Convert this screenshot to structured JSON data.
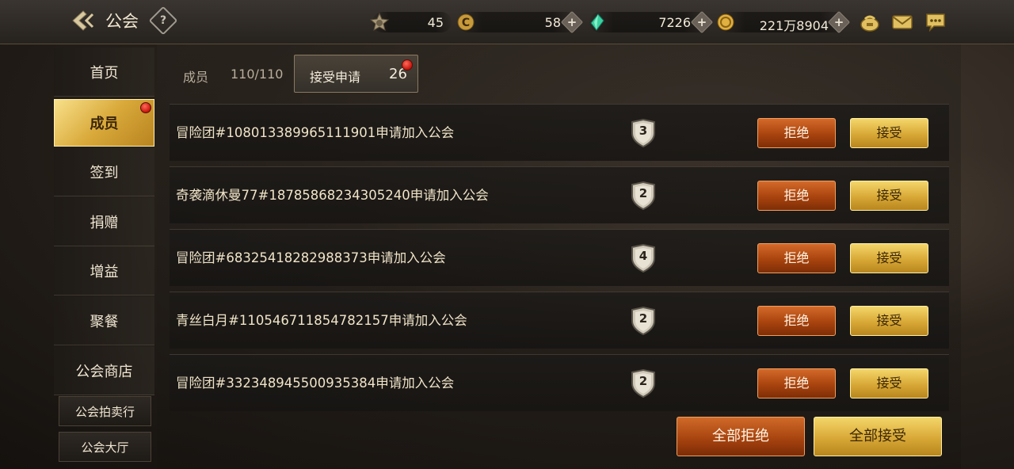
{
  "header": {
    "title": "公会",
    "help_label": "?",
    "resources": [
      {
        "icon": "star-badge-icon",
        "value": "45"
      },
      {
        "icon": "c-coin-icon",
        "value": "58"
      },
      {
        "icon": "green-crystal-icon",
        "value": "7226"
      },
      {
        "icon": "gold-coin-icon",
        "value": "221万8904"
      }
    ],
    "plus_label": "+",
    "right_icons": [
      "bag-icon",
      "mail-icon",
      "chat-icon"
    ]
  },
  "sidebar": {
    "items": [
      {
        "label": "首页"
      },
      {
        "label": "成员"
      },
      {
        "label": "签到"
      },
      {
        "label": "捐赠"
      },
      {
        "label": "增益"
      },
      {
        "label": "聚餐"
      },
      {
        "label": "公会商店"
      }
    ],
    "sub_items": [
      {
        "label": "公会拍卖行"
      },
      {
        "label": "公会大厅"
      }
    ]
  },
  "tabs": {
    "members_label": "成员",
    "members_count": "110/110",
    "requests_label": "接受申请",
    "requests_count": "26"
  },
  "requests": [
    {
      "text": "冒险团#108013389965111901申请加入公会",
      "level": "3"
    },
    {
      "text": "奇袭滴休曼77#18785868234305240申请加入公会",
      "level": "2"
    },
    {
      "text": "冒险团#68325418282988373申请加入公会",
      "level": "4"
    },
    {
      "text": "青丝白月#110546711854782157申请加入公会",
      "level": "2"
    },
    {
      "text": "冒险团#332348945500935384申请加入公会",
      "level": "2"
    }
  ],
  "buttons": {
    "reject": "拒绝",
    "accept": "接受",
    "reject_all": "全部拒绝",
    "accept_all": "全部接受"
  }
}
